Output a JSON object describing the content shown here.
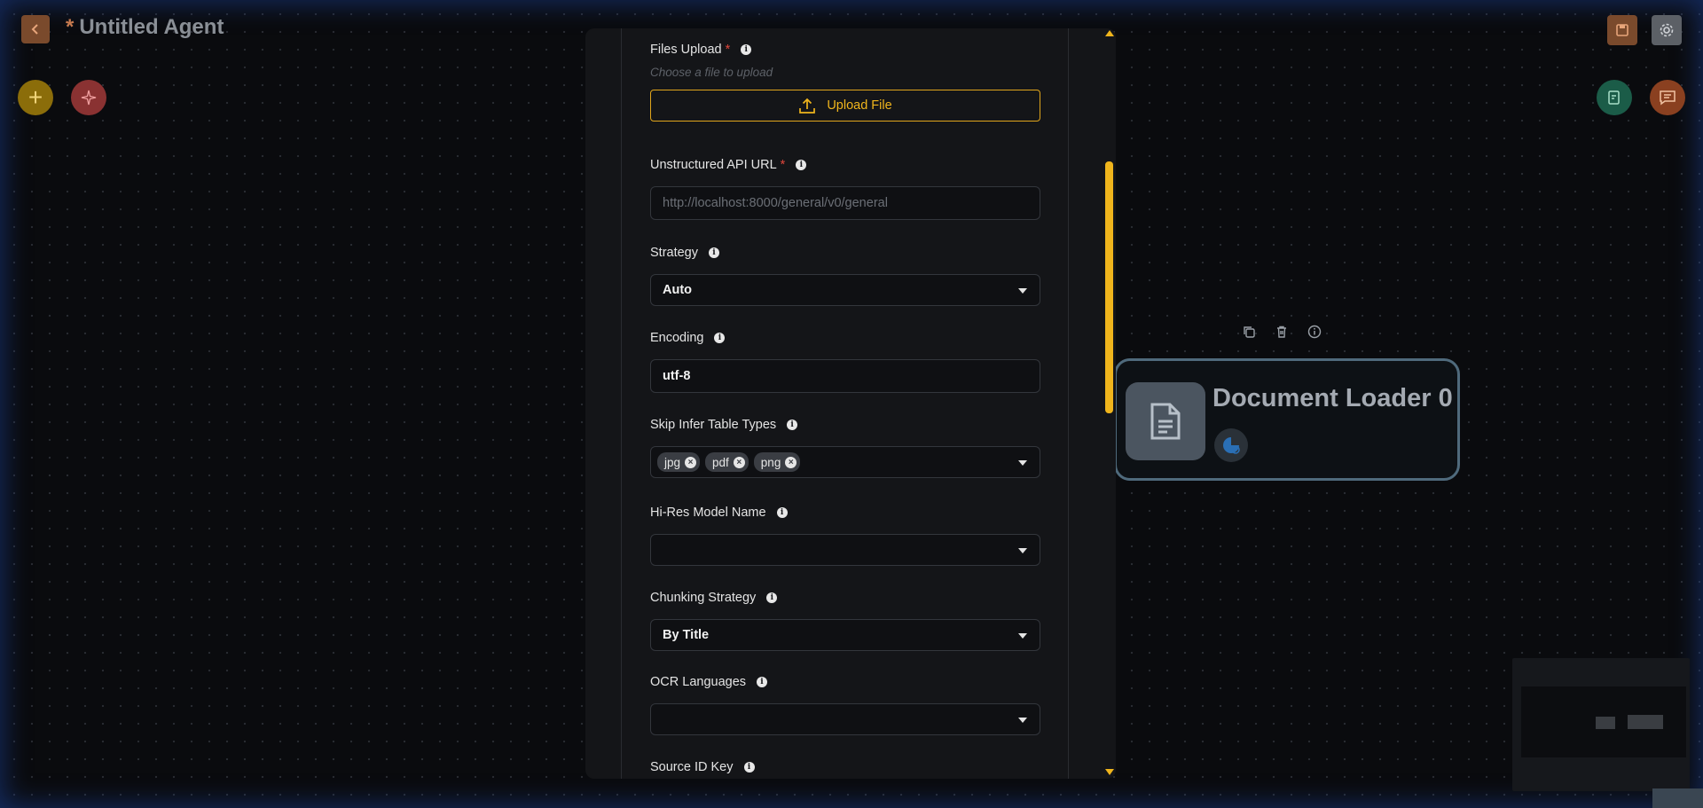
{
  "header": {
    "title_star": "*",
    "title": "Untitled Agent"
  },
  "panel": {
    "files_upload": {
      "label": "Files Upload",
      "required": "*",
      "hint": "Choose a file to upload",
      "button": "Upload File"
    },
    "api_url": {
      "label": "Unstructured API URL",
      "required": "*",
      "placeholder": "http://localhost:8000/general/v0/general"
    },
    "strategy": {
      "label": "Strategy",
      "value": "Auto"
    },
    "encoding": {
      "label": "Encoding",
      "value": "utf-8"
    },
    "skip_infer": {
      "label": "Skip Infer Table Types",
      "chips": [
        "jpg",
        "pdf",
        "png"
      ]
    },
    "hires_model": {
      "label": "Hi-Res Model Name",
      "value": ""
    },
    "chunking": {
      "label": "Chunking Strategy",
      "value": "By Title"
    },
    "ocr": {
      "label": "OCR Languages",
      "value": ""
    },
    "source_id": {
      "label": "Source ID Key"
    }
  },
  "node": {
    "title": "Document Loader 0"
  },
  "colors": {
    "accent": "#f0b51c",
    "required": "#e0463b",
    "node_border": "#4f6a7c"
  },
  "icons": {
    "back": "chevron-left-icon",
    "save": "save-icon",
    "settings": "gear-icon",
    "add": "plus-icon",
    "magic": "sparkles-icon",
    "validate": "checklist-icon",
    "chat": "chat-icon",
    "upload": "upload-icon",
    "copy": "copy-icon",
    "delete": "trash-icon",
    "info": "info-icon",
    "document": "document-icon"
  }
}
